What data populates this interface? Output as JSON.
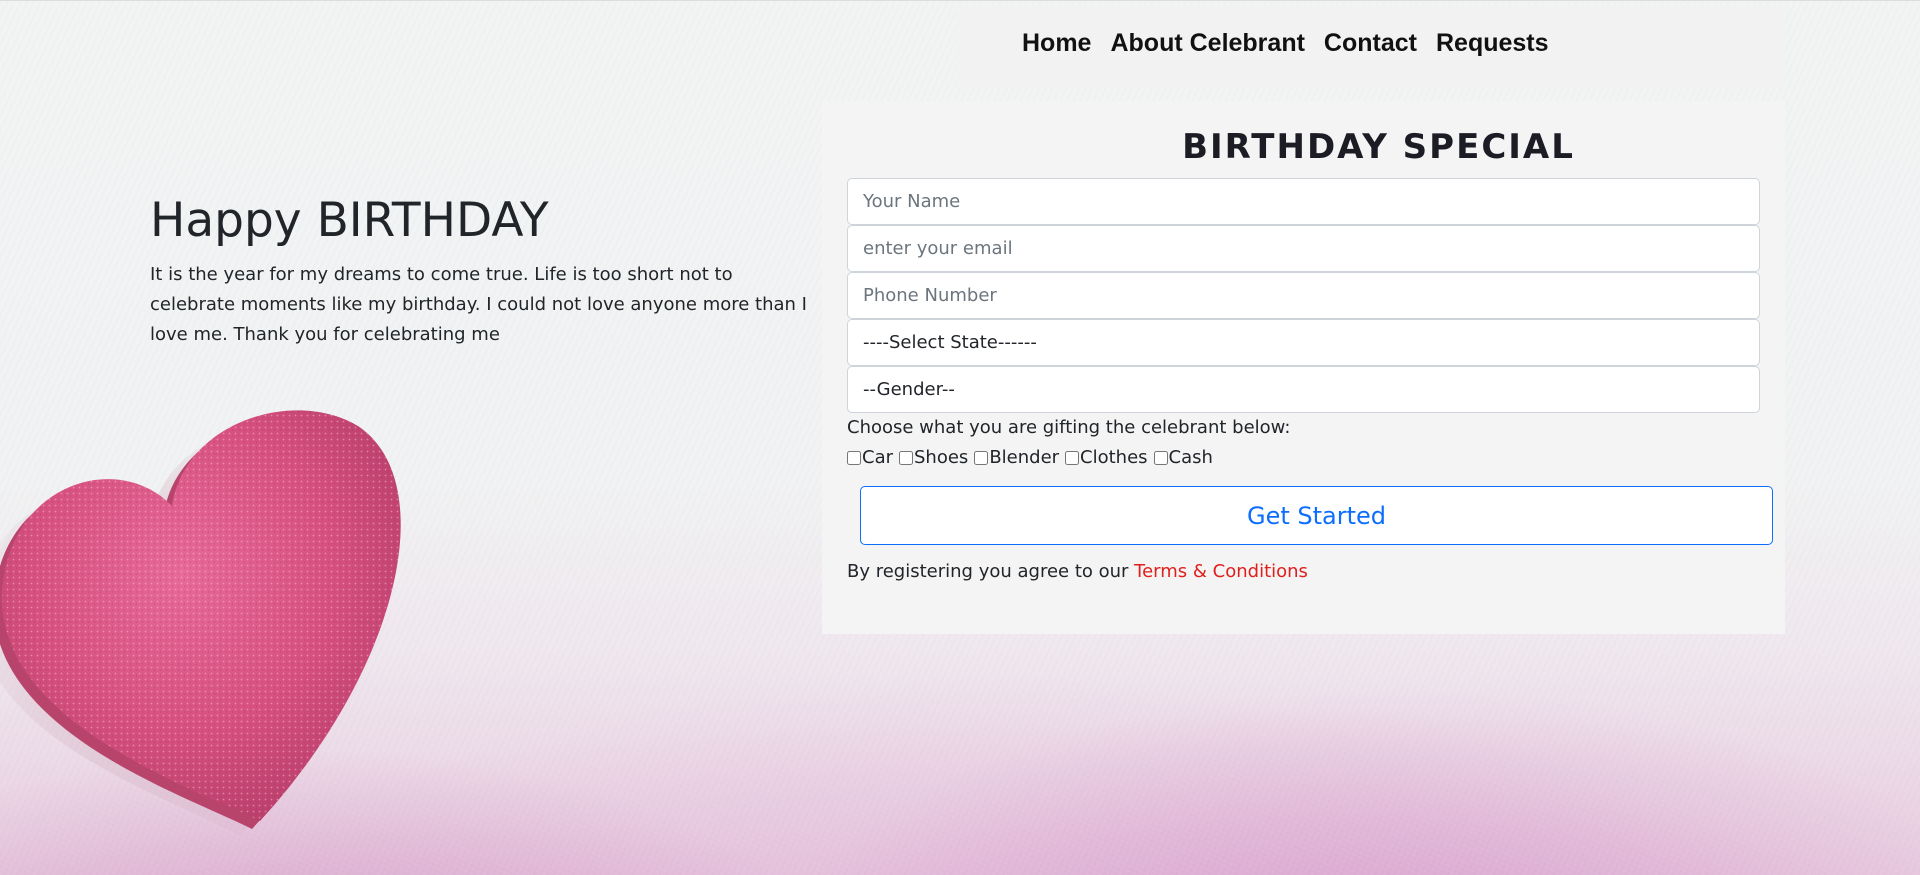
{
  "nav": {
    "links": [
      "Home",
      "About Celebrant",
      "Contact",
      "Requests"
    ]
  },
  "hero": {
    "title": "Happy BIRTHDAY",
    "text": "It is the year for my dreams to come true. Life is too short not to celebrate moments like my birthday. I could not love anyone more than I love me. Thank you for celebrating me"
  },
  "form": {
    "title": "BIRTHDAY SPECIAL",
    "name_placeholder": "Your Name",
    "email_placeholder": "enter your email",
    "phone_placeholder": "Phone Number",
    "state_selected": "----Select State------",
    "gender_selected": "--Gender--",
    "gift_prompt": "Choose what you are gifting the celebrant below:",
    "gift_options": [
      "Car",
      "Shoes",
      "Blender",
      "Clothes",
      "Cash"
    ],
    "submit_label": "Get Started",
    "terms_prefix": "By registering you agree to our",
    "terms_link": "Terms & Conditions"
  },
  "colors": {
    "accent": "#0d6efd",
    "terms_link": "#e0201c",
    "heart": "#d6507f",
    "panel": "#f4f4f4"
  },
  "icons": {
    "decoration": "heart-icon"
  }
}
